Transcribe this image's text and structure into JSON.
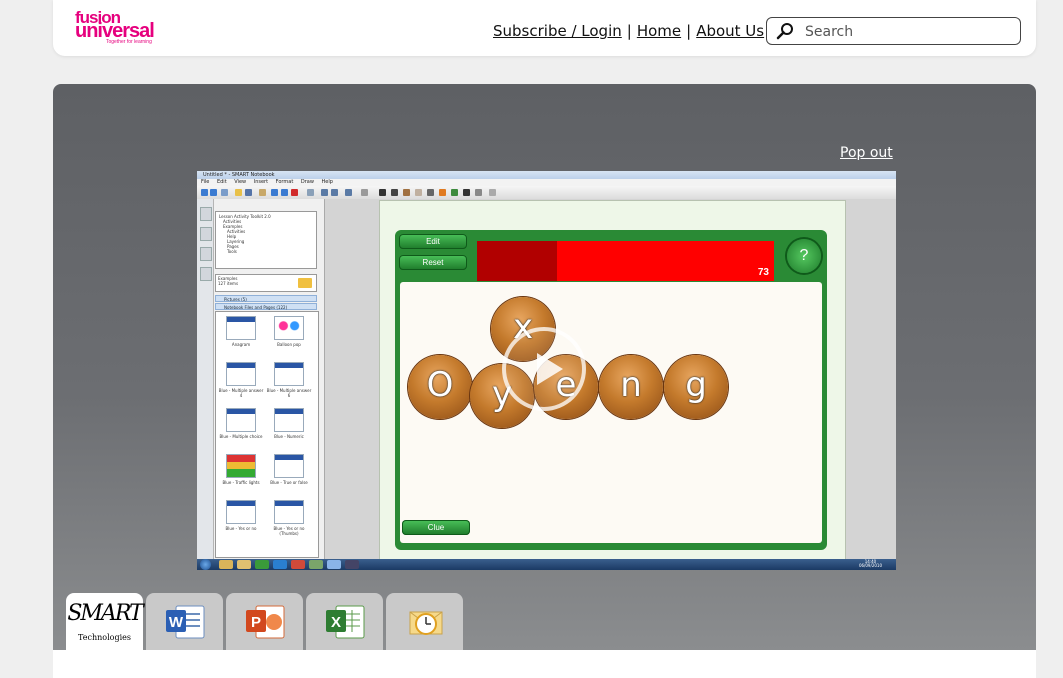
{
  "header": {
    "logo": {
      "line1": "fusion",
      "line2": "universal",
      "tagline": "Together for learning"
    },
    "nav": [
      {
        "label": "Subscribe / Login"
      },
      {
        "label": "Home"
      },
      {
        "label": "About Us"
      }
    ],
    "separator": "|",
    "search": {
      "placeholder": "Search",
      "value": ""
    }
  },
  "player": {
    "popout_label": "Pop out",
    "app": {
      "window_title": "Untitled * - SMART Notebook",
      "menu": [
        "File",
        "Edit",
        "View",
        "Insert",
        "Format",
        "Draw",
        "Help"
      ],
      "folder_tree": [
        "Lesson Activity Toolkit 2.0",
        "Activities",
        "Examples",
        "Activities",
        "Help",
        "Layering",
        "Pages",
        "Tools"
      ],
      "gallery_header": {
        "title": "Examples",
        "count": "127 items"
      },
      "gallery_rows": [
        "Pictures (5)",
        "Notebook Files and Pages (122)"
      ],
      "thumbnails": [
        "Anagram",
        "Balloon pop",
        "Blue - Multiple answer 4",
        "Blue - Multiple answer 6",
        "Blue - Multiple choice",
        "Blue - Numeric",
        "Blue - Traffic lights",
        "Blue - True or false",
        "Blue - Yes or no",
        "Blue - Yes or no (Thumbs)"
      ],
      "game": {
        "edit_label": "Edit",
        "reset_label": "Reset",
        "clue_label": "Clue",
        "help_label": "?",
        "timer_value": "73",
        "timer_elapsed_fraction": 0.27,
        "letters": [
          "x",
          "O",
          "y",
          "e",
          "n",
          "g"
        ]
      },
      "taskbar": {
        "time": "14:40",
        "date": "06/09/2010"
      }
    }
  },
  "app_tabs": [
    {
      "id": "smart",
      "label_line1": "SMART",
      "label_line2": "Technologies",
      "active": true
    },
    {
      "id": "word",
      "icon": "word-icon",
      "active": false
    },
    {
      "id": "powerpoint",
      "icon": "powerpoint-icon",
      "active": false
    },
    {
      "id": "excel",
      "icon": "excel-icon",
      "active": false
    },
    {
      "id": "outlook",
      "icon": "outlook-icon",
      "active": false
    }
  ],
  "colors": {
    "brand_pink": "#e6007e",
    "panel_dark": "#5e6064",
    "game_green": "#2a8a35",
    "timer_red": "#ff0000"
  }
}
